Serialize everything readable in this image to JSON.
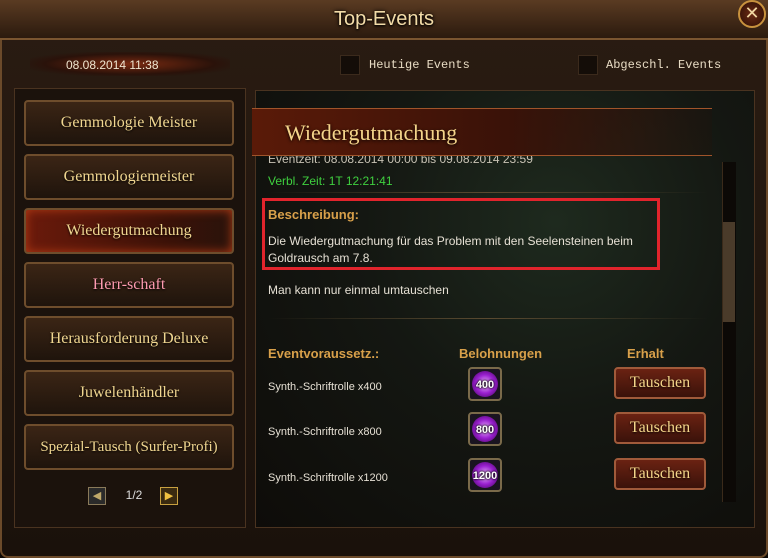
{
  "window": {
    "title": "Top-Events",
    "close_glyph": "✕"
  },
  "date": "08.08.2014 11:38",
  "filters": [
    {
      "label": "Heutige Events",
      "checked": false
    },
    {
      "label": "Abgeschl. Events",
      "checked": false
    }
  ],
  "sidebar": {
    "items": [
      {
        "label": "Gemmologie Meister",
        "active": false
      },
      {
        "label": "Gemmologiemeister",
        "active": false
      },
      {
        "label": "Wiedergutmachung",
        "active": true
      },
      {
        "label": "Herr-schaft",
        "active": false,
        "color": "#ff9bb1"
      },
      {
        "label": "Herausforderung Deluxe",
        "active": false
      },
      {
        "label": "Juwelenhändler",
        "active": false
      },
      {
        "label": "Spezial-Tausch (Surfer-Profi)",
        "active": false
      }
    ],
    "pager": {
      "prev": "◀",
      "next": "▶",
      "page": "1/2"
    }
  },
  "detail": {
    "title": "Wiedergutmachung",
    "event_time": "Eventzeit: 08.08.2014 00:00 bis 09.08.2014 23:59",
    "remaining": "Verbl. Zeit: 1T 12:21:41",
    "description_header": "Beschreibung:",
    "description": "Die Wiedergutmachung für das Problem mit den Seelensteinen beim Goldrausch am 7.8.",
    "note": "Man kann nur einmal umtauschen",
    "columns": {
      "requirements": "Eventvoraussetz.:",
      "rewards": "Belohnungen",
      "receive": "Erhalt"
    },
    "rows": [
      {
        "requirement": "Synth.-Schriftrolle x400",
        "reward_count": "400",
        "button": "Tauschen"
      },
      {
        "requirement": "Synth.-Schriftrolle x800",
        "reward_count": "800",
        "button": "Tauschen"
      },
      {
        "requirement": "Synth.-Schriftrolle x1200",
        "reward_count": "1200",
        "button": "Tauschen"
      }
    ]
  },
  "colors": {
    "highlight_box": "#e1242c",
    "remaining_time": "#3fcf3f",
    "header_gold": "#d8a04a"
  }
}
